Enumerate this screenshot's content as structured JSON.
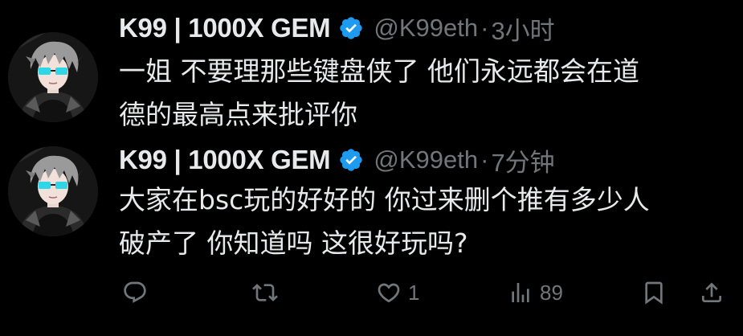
{
  "colors": {
    "background": "#000000",
    "text_primary": "#e7e9ea",
    "text_secondary": "#71767b",
    "verified_blue": "#1d9bf0"
  },
  "tweets": [
    {
      "author": {
        "display_name": "K99 | 1000X GEM",
        "verified": true,
        "handle": "@K99eth",
        "avatar_icon": "anime-avatar"
      },
      "separator": "·",
      "time": "3小时",
      "text_lines": [
        "一姐 不要理那些键盘侠了 他们永远都会在道",
        "德的最高点来批评你"
      ]
    },
    {
      "author": {
        "display_name": "K99 | 1000X GEM",
        "verified": true,
        "handle": "@K99eth",
        "avatar_icon": "anime-avatar"
      },
      "separator": "·",
      "time": "7分钟",
      "text_lines": [
        "大家在bsc玩的好好的 你过来删个推有多少人",
        "破产了 你知道吗 这很好玩吗?"
      ],
      "actions": {
        "reply": {
          "icon": "reply-icon",
          "count": ""
        },
        "retweet": {
          "icon": "retweet-icon",
          "count": ""
        },
        "like": {
          "icon": "heart-icon",
          "count": "1"
        },
        "views": {
          "icon": "views-icon",
          "count": "89"
        },
        "bookmark": {
          "icon": "bookmark-icon",
          "count": ""
        },
        "share": {
          "icon": "share-icon",
          "count": ""
        }
      }
    }
  ]
}
